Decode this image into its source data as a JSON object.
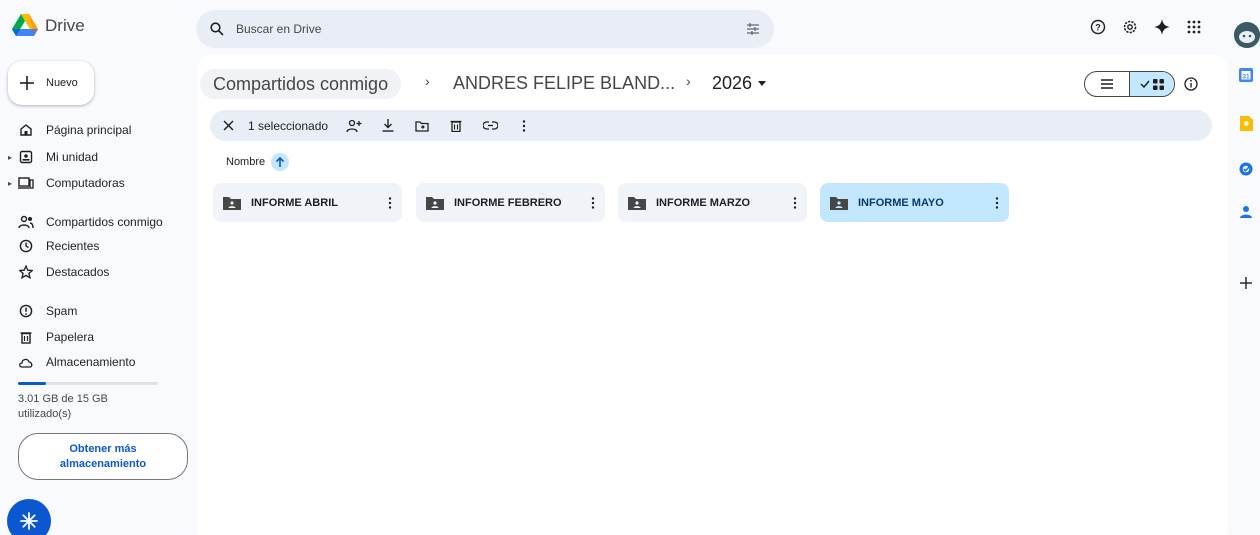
{
  "app": {
    "name": "Drive"
  },
  "search": {
    "placeholder": "Buscar en Drive"
  },
  "sidebar": {
    "new_label": "Nuevo",
    "items": [
      {
        "label": "Página principal",
        "icon": "home-icon"
      },
      {
        "label": "Mi unidad",
        "icon": "my-drive-icon"
      },
      {
        "label": "Computadoras",
        "icon": "computers-icon"
      },
      {
        "label": "Compartidos conmigo",
        "icon": "shared-icon"
      },
      {
        "label": "Recientes",
        "icon": "clock-icon"
      },
      {
        "label": "Destacados",
        "icon": "star-icon"
      },
      {
        "label": "Spam",
        "icon": "spam-icon"
      },
      {
        "label": "Papelera",
        "icon": "trash-icon"
      },
      {
        "label": "Almacenamiento",
        "icon": "cloud-icon"
      }
    ],
    "storage": {
      "text": "3.01 GB de 15 GB utilizado(s)",
      "used_fraction": 0.2
    },
    "more_storage_label": "Obtener más almacenamiento"
  },
  "breadcrumb": {
    "root": "Compartidos conmigo",
    "middle": "ANDRES FELIPE BLAND...",
    "current": "2026"
  },
  "toolbar": {
    "selection_label": "1 seleccionado"
  },
  "sort": {
    "label": "Nombre"
  },
  "folders": [
    {
      "name": "INFORME ABRIL",
      "selected": false
    },
    {
      "name": "INFORME FEBRERO",
      "selected": false
    },
    {
      "name": "INFORME MARZO",
      "selected": false
    },
    {
      "name": "INFORME MAYO",
      "selected": true
    }
  ],
  "colors": {
    "accent": "#0b57d0",
    "selected": "#c2e7ff",
    "surface": "#f8fafd"
  }
}
